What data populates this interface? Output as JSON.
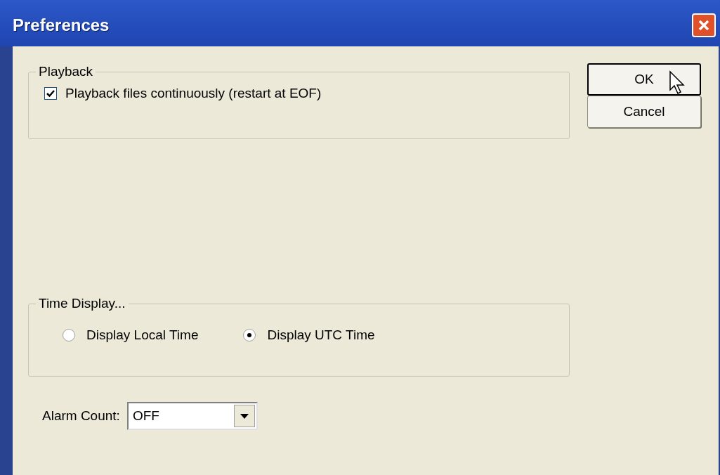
{
  "window": {
    "title": "Preferences"
  },
  "playback": {
    "legend": "Playback",
    "options": [
      {
        "label": "Playback files continuously (restart at EOF)",
        "checked": true
      }
    ]
  },
  "time_display": {
    "legend": "Time Display...",
    "options": [
      {
        "label": "Display Local Time",
        "selected": false
      },
      {
        "label": "Display UTC Time",
        "selected": true
      }
    ]
  },
  "alarm_count": {
    "label": "Alarm Count:",
    "value": "OFF"
  },
  "buttons": [
    {
      "label": "OK",
      "focused": true
    },
    {
      "label": "Cancel",
      "focused": false
    }
  ]
}
